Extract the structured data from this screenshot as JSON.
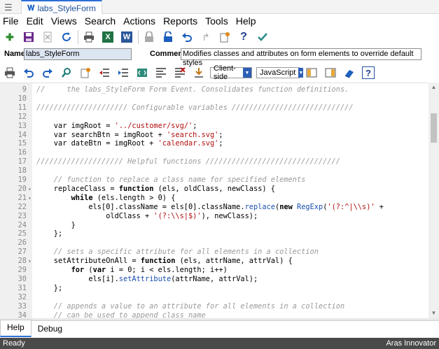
{
  "window": {
    "menu_glyph": "☰",
    "tab_icon": "𝐖",
    "tab_title": "labs_StyleForm"
  },
  "menubar": [
    "File",
    "Edit",
    "Views",
    "Search",
    "Actions",
    "Reports",
    "Tools",
    "Help"
  ],
  "fields": {
    "name_label": "Name",
    "name_value": "labs_StyleForm",
    "comment_label": "Comment",
    "comment_value": "Modifies classes and attributes on form elements to override default styles"
  },
  "toolbar2": {
    "location": "Client-side",
    "language": "JavaScript"
  },
  "code_lines": [
    {
      "n": "9",
      "fold": "",
      "segs": [
        {
          "c": "cm",
          "t": "//     the labs_StyleForm Form Event. Consolidates function definitions."
        }
      ]
    },
    {
      "n": "10",
      "fold": "",
      "segs": []
    },
    {
      "n": "11",
      "fold": "",
      "segs": [
        {
          "c": "cm",
          "t": "///////////////////// Configurable variables ////////////////////////////"
        }
      ]
    },
    {
      "n": "12",
      "fold": "",
      "segs": []
    },
    {
      "n": "13",
      "fold": "",
      "segs": [
        {
          "c": "",
          "t": "    var imgRoot = "
        },
        {
          "c": "str",
          "t": "'../customer/svg/'"
        },
        {
          "c": "",
          "t": ";"
        }
      ]
    },
    {
      "n": "14",
      "fold": "",
      "segs": [
        {
          "c": "",
          "t": "    var searchBtn = imgRoot + "
        },
        {
          "c": "str",
          "t": "'search.svg'"
        },
        {
          "c": "",
          "t": ";"
        }
      ]
    },
    {
      "n": "15",
      "fold": "",
      "segs": [
        {
          "c": "",
          "t": "    var dateBtn = imgRoot + "
        },
        {
          "c": "str",
          "t": "'calendar.svg'"
        },
        {
          "c": "",
          "t": ";"
        }
      ]
    },
    {
      "n": "16",
      "fold": "",
      "segs": []
    },
    {
      "n": "17",
      "fold": "",
      "segs": [
        {
          "c": "cm",
          "t": "//////////////////// Helpful functions ///////////////////////////////"
        }
      ]
    },
    {
      "n": "18",
      "fold": "",
      "segs": []
    },
    {
      "n": "19",
      "fold": "",
      "segs": [
        {
          "c": "cm",
          "t": "    // function to replace a class name for specified elements"
        }
      ]
    },
    {
      "n": "20",
      "fold": "▾",
      "segs": [
        {
          "c": "",
          "t": "    replaceClass = "
        },
        {
          "c": "kw",
          "t": "function"
        },
        {
          "c": "",
          "t": " (els, oldClass, newClass) {"
        }
      ]
    },
    {
      "n": "21",
      "fold": "▾",
      "segs": [
        {
          "c": "",
          "t": "        "
        },
        {
          "c": "kw",
          "t": "while"
        },
        {
          "c": "",
          "t": " (els.length > 0) {"
        }
      ]
    },
    {
      "n": "22",
      "fold": "",
      "segs": [
        {
          "c": "",
          "t": "            els[0].className = els[0].className."
        },
        {
          "c": "fn",
          "t": "replace"
        },
        {
          "c": "",
          "t": "("
        },
        {
          "c": "kw",
          "t": "new"
        },
        {
          "c": "",
          "t": " "
        },
        {
          "c": "fn",
          "t": "RegExp"
        },
        {
          "c": "",
          "t": "("
        },
        {
          "c": "str",
          "t": "'(?:^|\\\\s)'"
        },
        {
          "c": "",
          "t": " +"
        }
      ]
    },
    {
      "n": "23",
      "fold": "",
      "segs": [
        {
          "c": "",
          "t": "                oldClass + "
        },
        {
          "c": "str",
          "t": "'(?:\\\\s|$)'"
        },
        {
          "c": "",
          "t": "), newClass);"
        }
      ]
    },
    {
      "n": "24",
      "fold": "",
      "segs": [
        {
          "c": "",
          "t": "        }"
        }
      ]
    },
    {
      "n": "25",
      "fold": "",
      "segs": [
        {
          "c": "",
          "t": "    };"
        }
      ]
    },
    {
      "n": "26",
      "fold": "",
      "segs": []
    },
    {
      "n": "27",
      "fold": "",
      "segs": [
        {
          "c": "cm",
          "t": "    // sets a specific attribute for all elements in a collection"
        }
      ]
    },
    {
      "n": "28",
      "fold": "▾",
      "segs": [
        {
          "c": "",
          "t": "    setAttributeOnAll = "
        },
        {
          "c": "kw",
          "t": "function"
        },
        {
          "c": "",
          "t": " (els, attrName, attrVal) {"
        }
      ]
    },
    {
      "n": "29",
      "fold": "",
      "segs": [
        {
          "c": "",
          "t": "        "
        },
        {
          "c": "kw",
          "t": "for"
        },
        {
          "c": "",
          "t": " ("
        },
        {
          "c": "kw",
          "t": "var"
        },
        {
          "c": "",
          "t": " i = 0; i < els.length; i++)"
        }
      ]
    },
    {
      "n": "30",
      "fold": "",
      "segs": [
        {
          "c": "",
          "t": "            els[i]."
        },
        {
          "c": "fn",
          "t": "setAttribute"
        },
        {
          "c": "",
          "t": "(attrName, attrVal);"
        }
      ]
    },
    {
      "n": "31",
      "fold": "",
      "segs": [
        {
          "c": "",
          "t": "    };"
        }
      ]
    },
    {
      "n": "32",
      "fold": "",
      "segs": []
    },
    {
      "n": "33",
      "fold": "",
      "segs": [
        {
          "c": "cm",
          "t": "    // appends a value to an attribute for all elements in a collection"
        }
      ]
    },
    {
      "n": "34",
      "fold": "",
      "segs": [
        {
          "c": "cm",
          "t": "    // can be used to append class name"
        }
      ]
    }
  ],
  "bottom_tabs": [
    "Help",
    "Debug"
  ],
  "status": {
    "left": "Ready",
    "right": "Aras Innovator"
  }
}
